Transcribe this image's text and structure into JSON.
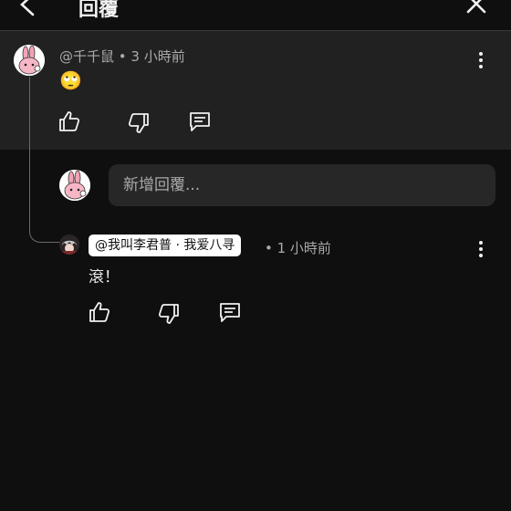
{
  "header": {
    "title": "回覆"
  },
  "parent_comment": {
    "meta": "@千千鼠 • 3 小時前",
    "text": "🙄"
  },
  "reply_box": {
    "placeholder": "新增回覆..."
  },
  "reply_comment": {
    "mention": "@我叫李君普 · 我爱八寻",
    "time": "• 1 小時前",
    "text": "滾！"
  },
  "colors": {
    "background": "#0f0f0f",
    "highlight_block": "#212121",
    "input_bg": "#272727",
    "secondary_text": "#aaaaaa"
  }
}
